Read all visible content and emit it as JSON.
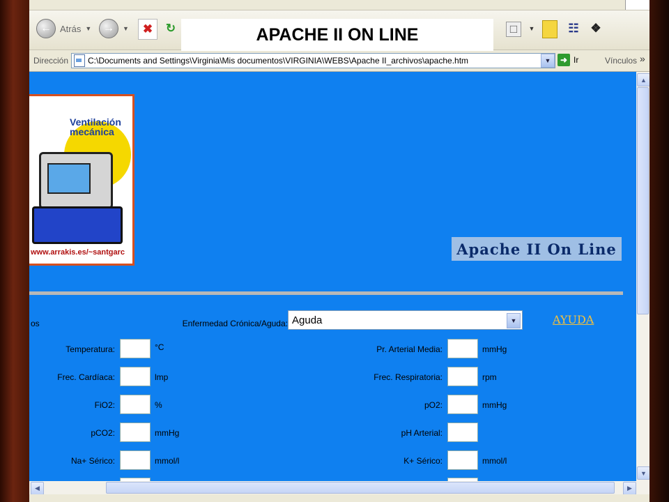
{
  "banner": {
    "title": "APACHE II ON LINE"
  },
  "toolbar": {
    "back_label": "Atrás"
  },
  "address_bar": {
    "label": "Dirección",
    "url": "C:\\Documents and Settings\\Virginia\\Mis documentos\\VIRGINIA\\WEBS\\Apache II_archivos\\apache.htm",
    "go_label": "Ir",
    "links_label": "Vínculos"
  },
  "logo": {
    "text_line1": "Ventilación",
    "text_line2": "mecánica",
    "url": "www.arrakis.es/~santgarc"
  },
  "page": {
    "heading": "Apache II On Line",
    "left_clip_text": "os",
    "help_link": "AYUDA",
    "chronic_label": "Enfermedad Crónica/Aguda:",
    "chronic_value": "Aguda"
  },
  "form": {
    "left": [
      {
        "label": "Temperatura:",
        "unit": "°C",
        "value": ""
      },
      {
        "label": "Frec. Cardíaca:",
        "unit": "lmp",
        "value": ""
      },
      {
        "label": "FiO2:",
        "unit": "%",
        "value": ""
      },
      {
        "label": "pCO2:",
        "unit": "mmHg",
        "value": ""
      },
      {
        "label": "Na+ Sérico:",
        "unit": "mmol/l",
        "value": ""
      }
    ],
    "right": [
      {
        "label": "Pr. Arterial Media:",
        "unit": "mmHg",
        "value": ""
      },
      {
        "label": "Frec. Respiratoria:",
        "unit": "rpm",
        "value": ""
      },
      {
        "label": "pO2:",
        "unit": "mmHg",
        "value": ""
      },
      {
        "label": "pH Arterial:",
        "unit": "",
        "value": ""
      },
      {
        "label": "K+ Sérico:",
        "unit": "mmol/l",
        "value": ""
      }
    ]
  },
  "colors": {
    "page_background": "#0f80f0",
    "help_link": "#f0c040",
    "title_box": "#9fbfe5"
  }
}
